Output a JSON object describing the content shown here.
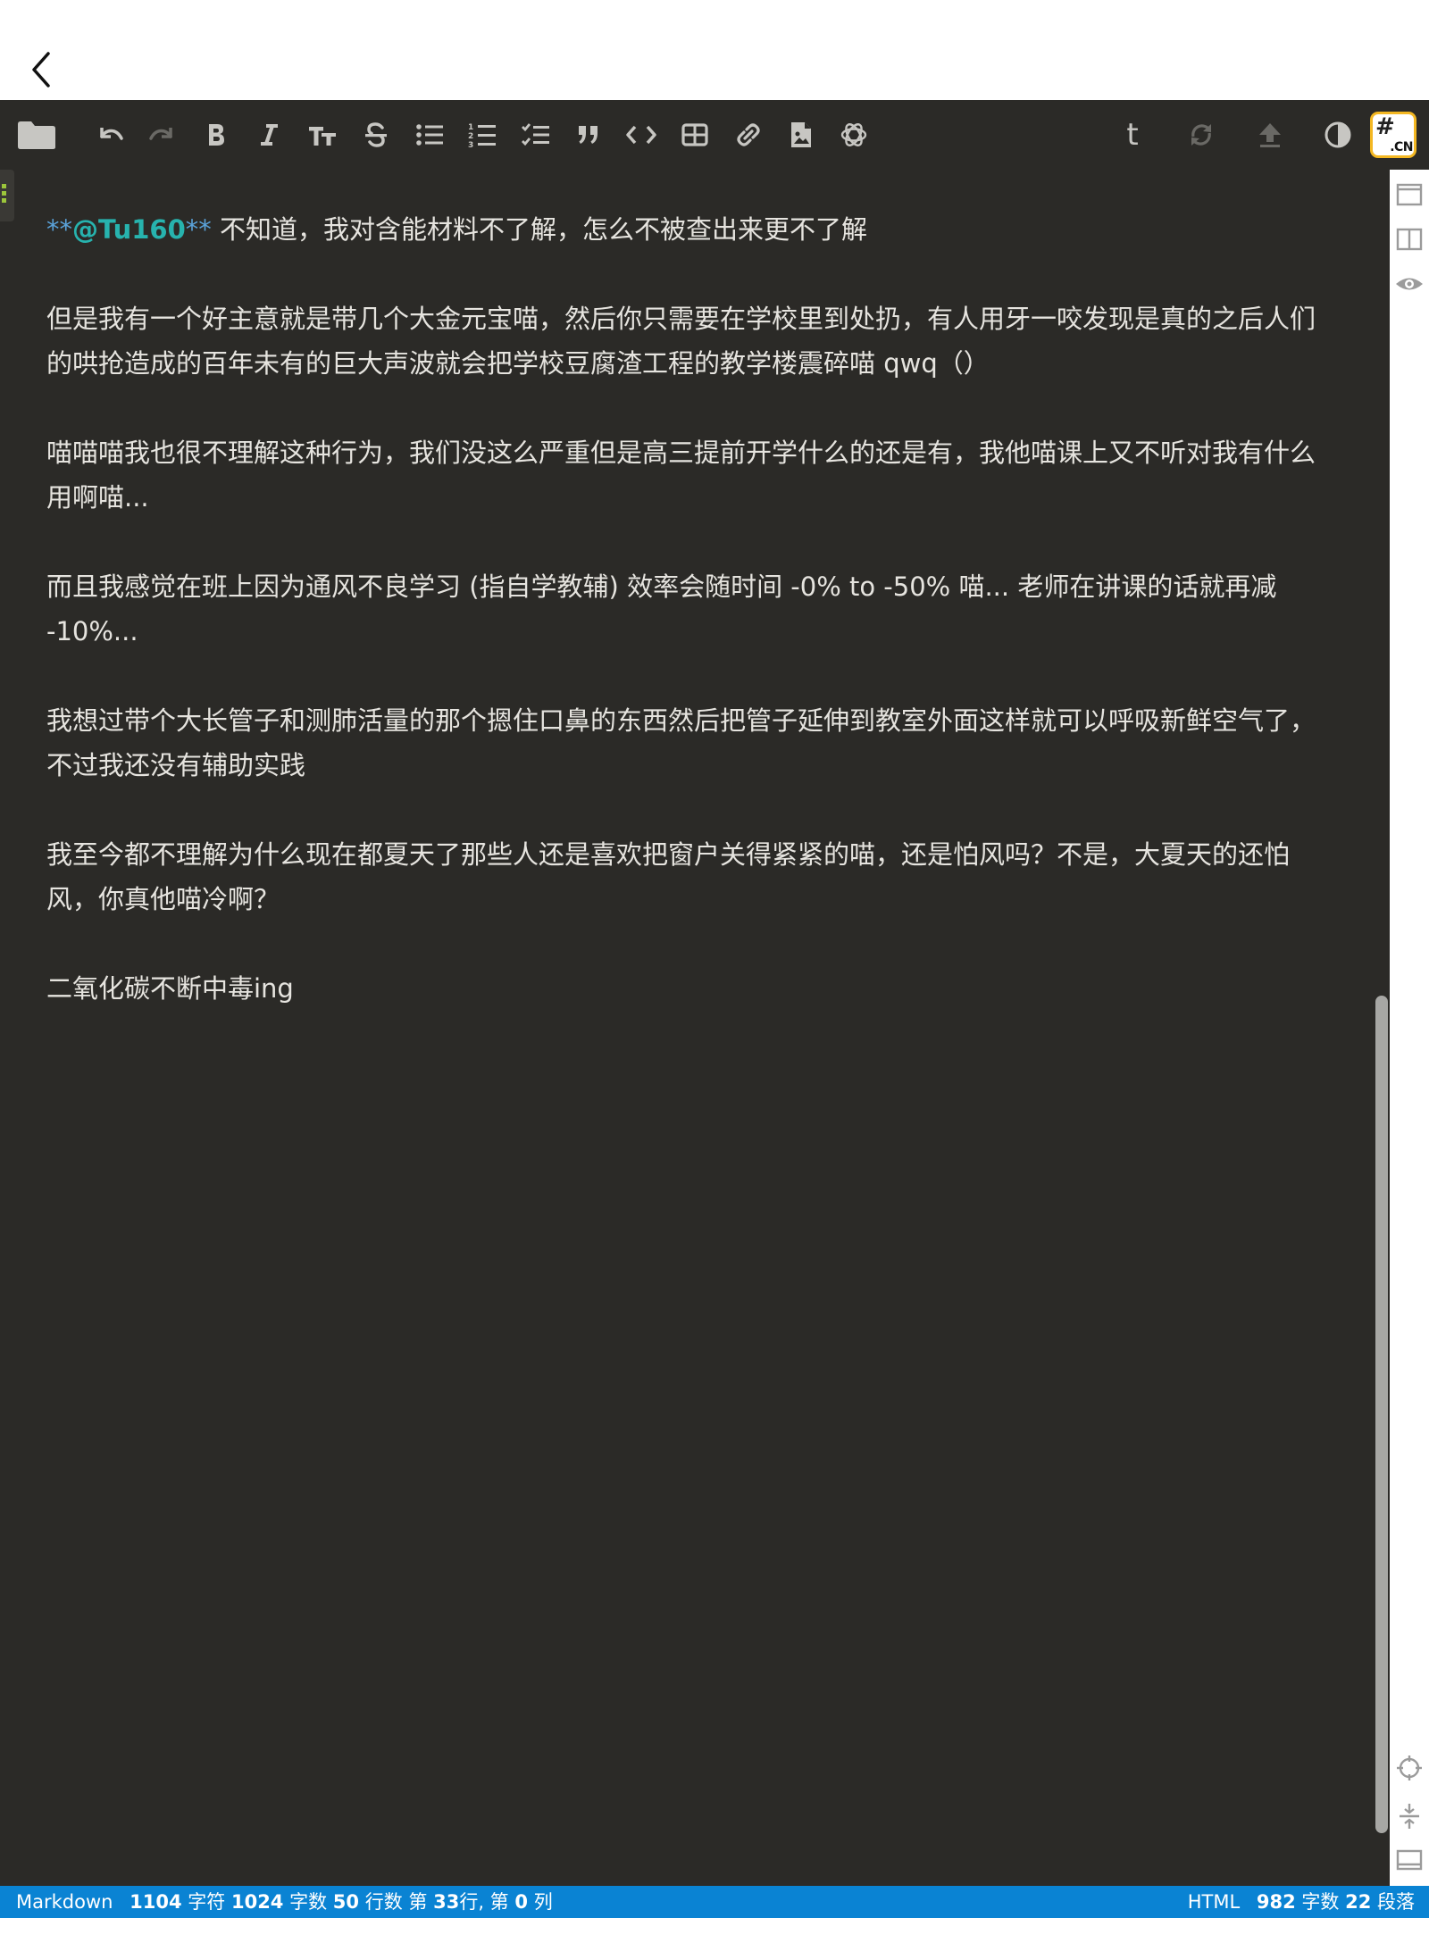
{
  "toolbar": {
    "buttons": [
      "folder-icon",
      "undo-icon",
      "redo-icon",
      "bold-icon",
      "italic-icon",
      "heading-icon",
      "strikethrough-icon",
      "bullet-list-icon",
      "numbered-list-icon",
      "checklist-icon",
      "quote-icon",
      "code-icon",
      "table-icon",
      "link-icon",
      "image-icon",
      "ai-icon",
      "t-icon",
      "sync-icon",
      "upload-icon",
      "theme-icon",
      "site-logo"
    ],
    "t_label": "t",
    "logo_text_top": "#",
    "logo_text_bottom": ".CN"
  },
  "editor": {
    "p1_stars_open": "**",
    "p1_mention": "@Tu160",
    "p1_stars_close": "**",
    "p1_text": " 不知道，我对含能材料不了解，怎么不被查出来更不了解",
    "p2": "但是我有一个好主意就是带几个大金元宝喵，然后你只需要在学校里到处扔，有人用牙一咬发现是真的之后人们的哄抢造成的百年未有的巨大声波就会把学校豆腐渣工程的教学楼震碎喵 qwq（）",
    "p3": "喵喵喵我也很不理解这种行为，我们没这么严重但是高三提前开学什么的还是有，我他喵课上又不听对我有什么用啊喵...",
    "p4": "而且我感觉在班上因为通风不良学习 (指自学教辅) 效率会随时间 -0% to -50% 喵... 老师在讲课的话就再减 -10%...",
    "p5": "我想过带个大长管子和测肺活量的那个摁住口鼻的东西然后把管子延伸到教室外面这样就可以呼吸新鲜空气了，不过我还没有辅助实践",
    "p6": "我至今都不理解为什么现在都夏天了那些人还是喜欢把窗户关得紧紧的喵，还是怕风吗？不是，大夏天的还怕风，你真他喵冷啊？",
    "p7": "二氧化碳不断中毒ing"
  },
  "status": {
    "mode": "Markdown",
    "chars": "1104",
    "chars_label": "字符",
    "words": "1024",
    "words_label": "字数",
    "lines": "50",
    "lines_label": "行数",
    "pos_prefix": "第",
    "line_no": "33",
    "line_label": "行, 第",
    "col_no": "0",
    "col_label": "列",
    "preview_mode": "HTML",
    "preview_words": "982",
    "preview_words_label": "字数",
    "paragraphs": "22",
    "paragraphs_label": "段落"
  },
  "sidebar": {
    "buttons": [
      "editor-only-icon",
      "split-view-icon",
      "preview-icon",
      "locate-icon",
      "sync-scroll-icon",
      "fullscreen-icon"
    ]
  }
}
